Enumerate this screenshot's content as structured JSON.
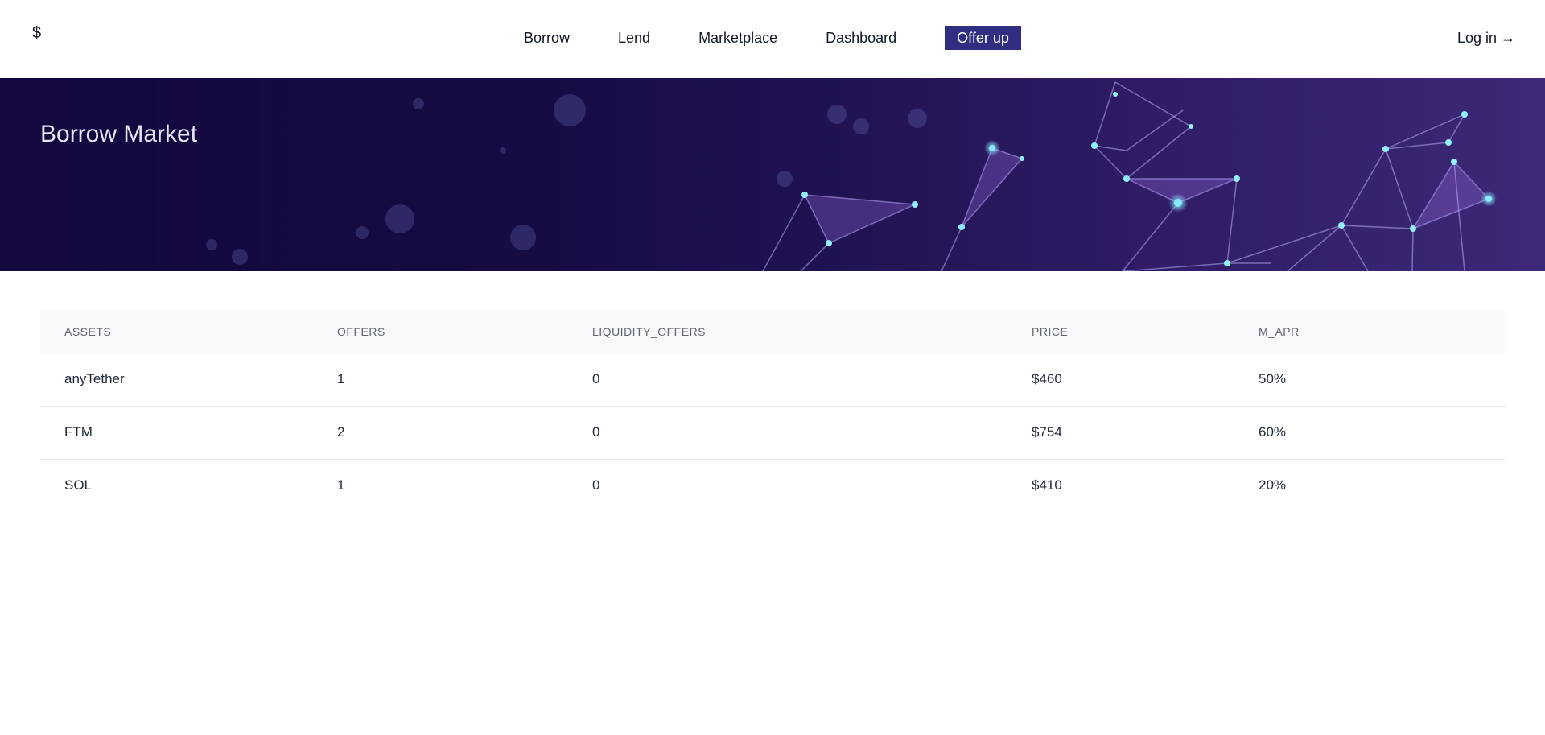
{
  "header": {
    "logo": "$",
    "nav": [
      "Borrow",
      "Lend",
      "Marketplace",
      "Dashboard"
    ],
    "cta": "Offer up",
    "login": "Log in →"
  },
  "hero": {
    "title": "Borrow Market"
  },
  "table": {
    "columns": [
      "ASSETS",
      "OFFERS",
      "LIQUIDITY_OFFERS",
      "PRICE",
      "M_APR"
    ],
    "rows": [
      [
        "anyTether",
        "1",
        "0",
        "$460",
        "50%"
      ],
      [
        "FTM",
        "2",
        "0",
        "$754",
        "60%"
      ],
      [
        "SOL",
        "1",
        "0",
        "$410",
        "20%"
      ]
    ]
  },
  "colors": {
    "accent": "#312e81",
    "hero_bg": "#14083f"
  }
}
